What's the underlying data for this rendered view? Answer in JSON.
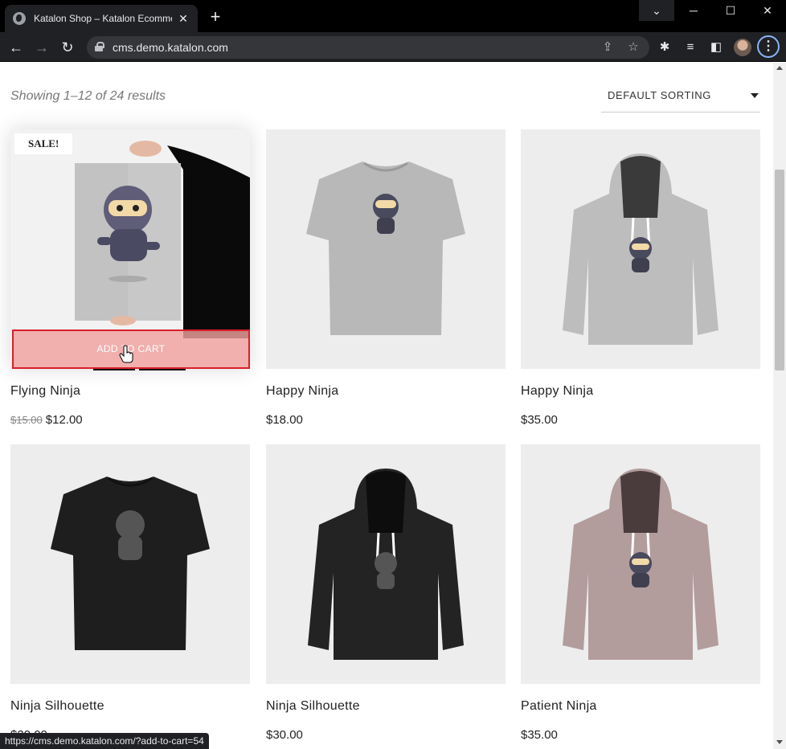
{
  "browser": {
    "tab_title": "Katalon Shop – Katalon Ecommer",
    "url": "cms.demo.katalon.com",
    "status_url": "https://cms.demo.katalon.com/?add-to-cart=54"
  },
  "shop": {
    "result_count": "Showing 1–12 of 24 results",
    "sorting": "DEFAULT SORTING",
    "products": [
      {
        "name": "Flying Ninja",
        "old_price": "$15.00",
        "price": "$12.00",
        "badge": "SALE!",
        "button": "ADD TO CART"
      },
      {
        "name": "Happy Ninja",
        "price": "$18.00"
      },
      {
        "name": "Happy Ninja",
        "price": "$35.00"
      },
      {
        "name": "Ninja Silhouette",
        "price": "$20.00"
      },
      {
        "name": "Ninja Silhouette",
        "price": "$30.00"
      },
      {
        "name": "Patient Ninja",
        "price": "$35.00"
      }
    ]
  },
  "colors": {
    "chrome_dark": "#202124",
    "add_to_cart_bg": "#f0a09e",
    "focus_border": "#d9202a"
  }
}
